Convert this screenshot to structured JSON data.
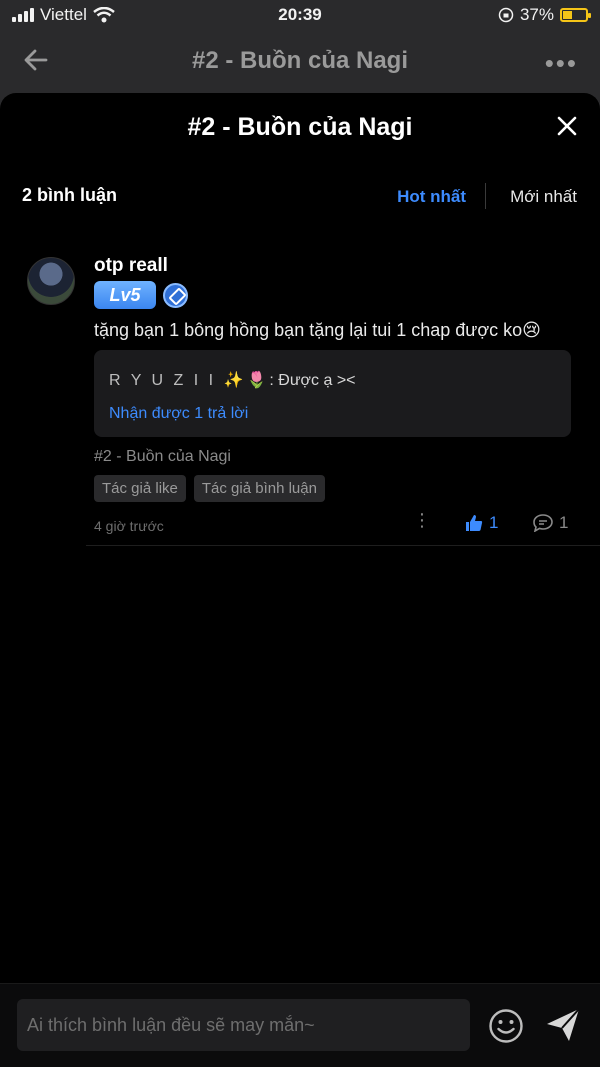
{
  "status_bar": {
    "carrier": "Viettel",
    "time": "20:39",
    "battery": "37%"
  },
  "background_page": {
    "title": "#2 - Buồn của Nagi"
  },
  "sheet": {
    "title": "#2 - Buồn của Nagi",
    "comment_count": "2 bình luận",
    "sort_hot": "Hot nhất",
    "sort_new": "Mới nhất"
  },
  "comment": {
    "username": "otp reall",
    "level": "Lv5",
    "text": "tặng bạn 1 bông hồng bạn tặng lại tui 1 chap được ko😢",
    "reply": {
      "author": "R Y U Z I I ✨🌷",
      "text": ": Được ạ ><",
      "more_link": "Nhận được 1 trả lời"
    },
    "chapter": "#2 - Buồn của Nagi",
    "tags": [
      "Tác giả like",
      "Tác giả bình luận"
    ],
    "time": "4 giờ trước",
    "likes": "1",
    "replies": "1"
  },
  "input": {
    "placeholder": "Ai thích bình luận đều sẽ may mắn~"
  },
  "colors": {
    "accent": "#3d8bfd",
    "background": "#000000"
  }
}
